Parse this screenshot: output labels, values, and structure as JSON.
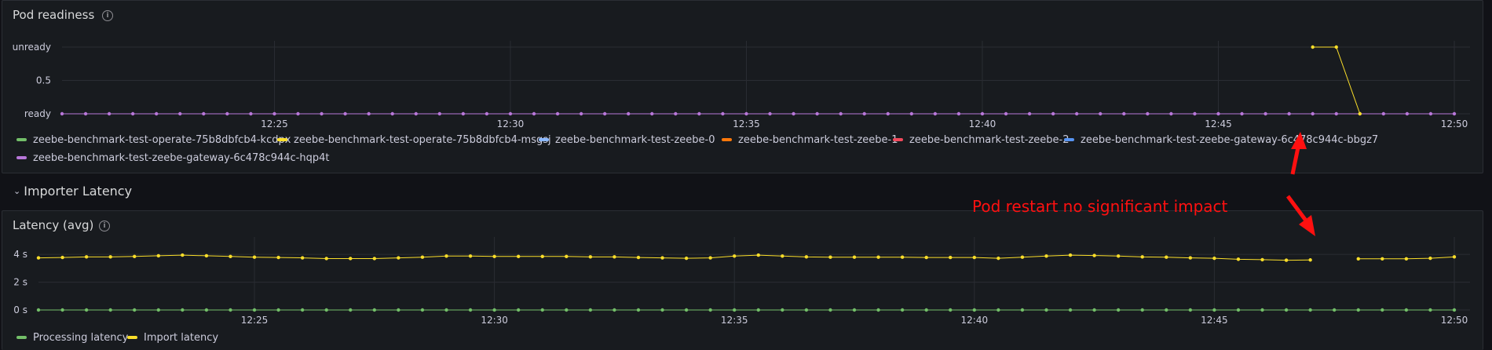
{
  "panels": {
    "readiness": {
      "title": "Pod readiness",
      "y_ticks": [
        "unready",
        "0.5",
        "ready"
      ],
      "x_ticks": [
        "12:25",
        "12:30",
        "12:35",
        "12:40",
        "12:45",
        "12:50"
      ],
      "legend": [
        {
          "label": "zeebe-benchmark-test-operate-75b8dbfcb4-kcdpx",
          "color": "#73bf69"
        },
        {
          "label": "zeebe-benchmark-test-operate-75b8dbfcb4-msgsj",
          "color": "#fade2a"
        },
        {
          "label": "zeebe-benchmark-test-zeebe-0",
          "color": "#8ab8ff"
        },
        {
          "label": "zeebe-benchmark-test-zeebe-1",
          "color": "#ff780a"
        },
        {
          "label": "zeebe-benchmark-test-zeebe-2",
          "color": "#f2495c"
        },
        {
          "label": "zeebe-benchmark-test-zeebe-gateway-6c478c944c-bbgz7",
          "color": "#5794f2"
        },
        {
          "label": "zeebe-benchmark-test-zeebe-gateway-6c478c944c-hqp4t",
          "color": "#b877d9"
        }
      ]
    },
    "latency": {
      "title": "Latency (avg)",
      "y_ticks": [
        "4 s",
        "2 s",
        "0 s"
      ],
      "x_ticks": [
        "12:25",
        "12:30",
        "12:35",
        "12:40",
        "12:45",
        "12:50"
      ],
      "legend": [
        {
          "label": "Processing latency",
          "color": "#73bf69"
        },
        {
          "label": "Import latency",
          "color": "#fade2a"
        }
      ]
    }
  },
  "row": {
    "title": "Importer Latency"
  },
  "annotation": {
    "text": "Pod restart no significant impact",
    "color": "#ff1010"
  },
  "chart_data": [
    {
      "type": "line",
      "title": "Pod readiness",
      "ylim": [
        0,
        1
      ],
      "y_tick_labels": [
        "ready",
        "0.5",
        "unready"
      ],
      "x_range": [
        "12:20:30",
        "12:50"
      ],
      "series": [
        {
          "name": "zeebe-benchmark-test-operate-75b8dbfcb4-msgsj",
          "x": [
            "12:47",
            "12:47:30",
            "12:48"
          ],
          "values": [
            1,
            1,
            0
          ]
        },
        {
          "name": "zeebe-benchmark-test-zeebe-gateway-6c478c944c-hqp4t",
          "x_start": "12:20:30",
          "x_step_seconds": 30,
          "count": 60,
          "values_constant": 0
        }
      ]
    },
    {
      "type": "line",
      "title": "Latency (avg)",
      "unit": "s",
      "ylim": [
        0,
        4.8
      ],
      "x_range": [
        "12:20:30",
        "12:50"
      ],
      "series": [
        {
          "name": "Processing latency",
          "x_start": "12:20:30",
          "x_step_seconds": 30,
          "count": 60,
          "values_constant": 0
        },
        {
          "name": "Import latency",
          "x_start": "12:20:30",
          "x_step_seconds": 30,
          "count": 60,
          "values": [
            3.75,
            3.78,
            3.82,
            3.82,
            3.85,
            3.9,
            3.95,
            3.9,
            3.85,
            3.8,
            3.78,
            3.75,
            3.7,
            3.7,
            3.7,
            3.75,
            3.8,
            3.88,
            3.88,
            3.85,
            3.85,
            3.85,
            3.85,
            3.82,
            3.82,
            3.78,
            3.75,
            3.72,
            3.75,
            3.88,
            3.95,
            3.88,
            3.82,
            3.8,
            3.8,
            3.8,
            3.8,
            3.78,
            3.78,
            3.78,
            3.72,
            3.8,
            3.88,
            3.95,
            3.92,
            3.88,
            3.82,
            3.8,
            3.75,
            3.72,
            3.65,
            3.62,
            3.58,
            3.6,
            null,
            3.68,
            3.68,
            3.68,
            3.72,
            3.82
          ]
        }
      ]
    }
  ]
}
